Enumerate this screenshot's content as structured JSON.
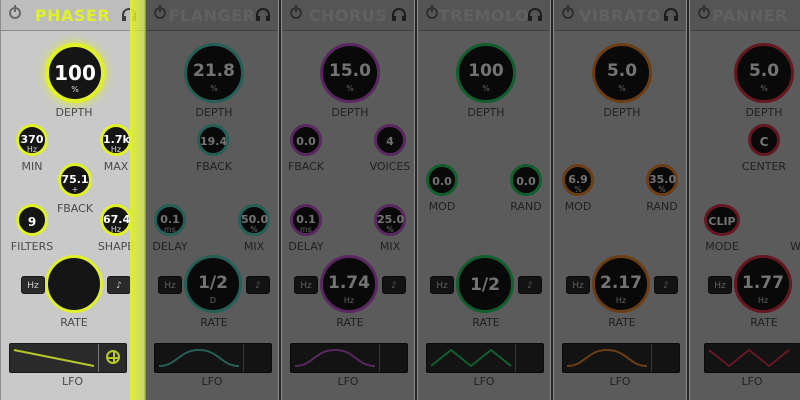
{
  "plugins": [
    {
      "name": "PHASER",
      "accent": "#e0f029",
      "knobs": {
        "depth": {
          "value": "100",
          "unit": "%",
          "label": "DEPTH"
        },
        "min": {
          "value": "370",
          "unit": "Hz",
          "label": "MIN"
        },
        "max": {
          "value": "1.7k",
          "unit": "Hz",
          "label": "MAX"
        },
        "fback": {
          "value": "75.1",
          "unit": "+",
          "label": "FBACK"
        },
        "filters": {
          "value": "9",
          "unit": "",
          "label": "FILTERS"
        },
        "shape": {
          "value": "67.4",
          "unit": "Hz",
          "label": "SHAPE"
        },
        "rate": {
          "value": "",
          "unit": "",
          "label": "RATE"
        }
      },
      "rate_buttons": [
        "Hz",
        "♪"
      ],
      "lfo_label": "LFO"
    },
    {
      "name": "FLANGER",
      "accent": "#55d0c3",
      "knobs": {
        "depth": {
          "value": "21.8",
          "unit": "%",
          "label": "DEPTH"
        },
        "fback": {
          "value": "19.4",
          "unit": "",
          "label": "FBACK"
        },
        "delay": {
          "value": "0.1",
          "unit": "ms",
          "label": "DELAY"
        },
        "mix": {
          "value": "50.0",
          "unit": "%",
          "label": "MIX"
        },
        "rate": {
          "value": "1/2",
          "unit": "D",
          "label": "RATE"
        }
      },
      "rate_buttons": [
        "Hz",
        "♪"
      ],
      "lfo_label": "LFO"
    },
    {
      "name": "CHORUS",
      "accent": "#c85ad6",
      "knobs": {
        "depth": {
          "value": "15.0",
          "unit": "%",
          "label": "DEPTH"
        },
        "fback": {
          "value": "0.0",
          "unit": "",
          "label": "FBACK"
        },
        "voices": {
          "value": "4",
          "unit": "",
          "label": "VOICES"
        },
        "delay": {
          "value": "0.1",
          "unit": "ms",
          "label": "DELAY"
        },
        "mix": {
          "value": "25.0",
          "unit": "%",
          "label": "MIX"
        },
        "rate": {
          "value": "1.74",
          "unit": "Hz",
          "label": "RATE"
        }
      },
      "rate_buttons": [
        "Hz",
        "♪"
      ],
      "lfo_label": "LFO"
    },
    {
      "name": "TREMOLO",
      "accent": "#29d167",
      "knobs": {
        "depth": {
          "value": "100",
          "unit": "%",
          "label": "DEPTH"
        },
        "mod": {
          "value": "0.0",
          "unit": "",
          "label": "MOD"
        },
        "rand": {
          "value": "0.0",
          "unit": "",
          "label": "RAND"
        },
        "rate": {
          "value": "1/2",
          "unit": "",
          "label": "RATE"
        }
      },
      "rate_buttons": [
        "Hz",
        "♪"
      ],
      "lfo_label": "LFO"
    },
    {
      "name": "VIBRATO",
      "accent": "#f08a2f",
      "knobs": {
        "depth": {
          "value": "5.0",
          "unit": "%",
          "label": "DEPTH"
        },
        "mod": {
          "value": "6.9",
          "unit": "%",
          "label": "MOD"
        },
        "rand": {
          "value": "35.0",
          "unit": "%",
          "label": "RAND"
        },
        "rate": {
          "value": "2.17",
          "unit": "Hz",
          "label": "RATE"
        }
      },
      "rate_buttons": [
        "Hz",
        "♪"
      ],
      "lfo_label": "LFO"
    },
    {
      "name": "PANNER",
      "accent": "#e0364d",
      "knobs": {
        "depth": {
          "value": "5.0",
          "unit": "%",
          "label": "DEPTH"
        },
        "center": {
          "value": "C",
          "unit": "",
          "label": "CENTER"
        },
        "mode": {
          "value": "CLIP",
          "unit": "",
          "label": "MODE"
        },
        "wave_label": "WA",
        "rate": {
          "value": "1.77",
          "unit": "Hz",
          "label": "RATE"
        }
      },
      "rate_buttons": [
        "Hz",
        "♪"
      ],
      "lfo_label": "LFO"
    }
  ]
}
